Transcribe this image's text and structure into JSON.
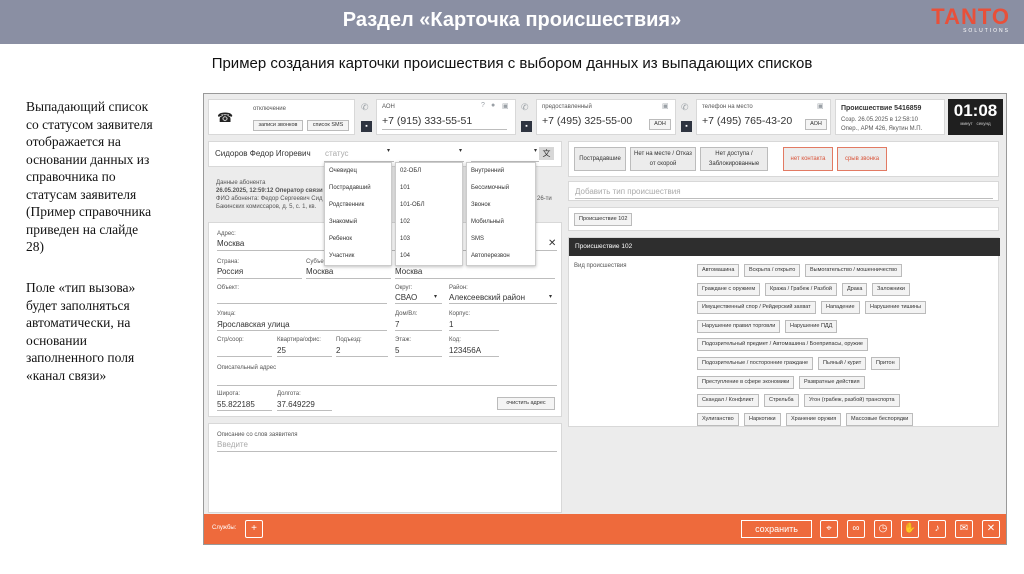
{
  "slide": {
    "title": "Раздел «Карточка происшествия»",
    "subtitle": "Пример создания карточки происшествия с выбором данных из выпадающих списков",
    "logo": {
      "brand": "TANTO",
      "sub": "SOLUTIONS"
    },
    "left_text": {
      "p1": [
        "Выпадающий список",
        "со статусом заявителя",
        "отображается на",
        "основании данных из",
        "справочника по",
        "статусам заявителя",
        "(Пример справочника",
        "приведен на слайде",
        "28)"
      ],
      "p2": [
        "Поле «тип вызова»",
        "будет заполняться",
        "автоматически, на",
        "основании",
        "заполненного поля",
        "«канал связи»"
      ]
    }
  },
  "app": {
    "header": {
      "status_label": "отключение",
      "btn_records": "записи звонков",
      "btn_sms": "список SMS",
      "aon_label": "АОН",
      "aon_number": "+7 (915) 333-55-51",
      "provided_label": "предоставленный",
      "provided_number": "+7 (495) 325-55-00",
      "aon_tag1": "АОН",
      "onsite_label": "телефон на место",
      "onsite_number": "+7 (495) 765-43-20",
      "aon_tag2": "АОН",
      "incident_title": "Происшествие 5416859",
      "incident_created": "Созр. 26.05.2025 в 12:58:10",
      "incident_operator": "Опер., АРМ 426, Якутин М.П.",
      "timer": "01:08",
      "timer_min": "минут",
      "timer_sec": "секунд"
    },
    "caller": {
      "name": "Сидоров Федор Игоревич",
      "status_placeholder": "статус",
      "subscriber_label": "Данные абонента",
      "subscriber_date": "26.05.2025, 12:59:12",
      "subscriber_op": "Оператор связи",
      "subscriber_fio": "ФИО абонента: Федор Сергеевич Сид",
      "subscriber_addr": "Бакинских комиссаров, д. 5, с. 1, кв.",
      "partial": "26-ти"
    },
    "dropdowns": {
      "status_options": [
        "Очевидец",
        "Пострадавший",
        "Родственник",
        "Знакомый",
        "Ребенок",
        "Участник"
      ],
      "channel_options": [
        "02-ОБЛ",
        "101",
        "101-ОБЛ",
        "102",
        "103",
        "104"
      ],
      "type_options": [
        "Внутренний",
        "Бессимочный",
        "Звонок",
        "Мобильный",
        "SMS",
        "Автоперезвон"
      ]
    },
    "address": {
      "address_label": "Адрес:",
      "address_value": "Москва",
      "country_label": "Страна:",
      "country_value": "Россия",
      "subject_label": "Субъект:",
      "subject_value": "Москва",
      "locality_value": "Москва",
      "object_label": "Объект:",
      "okrug_label": "Округ:",
      "okrug_value": "СВАО",
      "district_label": "Район:",
      "district_value": "Алексеевский район",
      "street_label": "Улица:",
      "street_value": "Ярославская улица",
      "house_label": "Дом/Вл:",
      "house_value": "7",
      "korpus_label": "Корпус:",
      "korpus_value": "1",
      "building_label": "Стр/соор:",
      "flat_label": "Квартира/офис:",
      "flat_value": "25",
      "entrance_label": "Подъезд:",
      "entrance_value": "2",
      "floor_label": "Этаж:",
      "floor_value": "5",
      "code_label": "Код:",
      "code_value": "123456А",
      "descr_label": "Описательный адрес",
      "lat_label": "Широта:",
      "lat_value": "55.822185",
      "lon_label": "Долгота:",
      "lon_value": "37.649229",
      "clear_btn": "очистить адрес"
    },
    "description": {
      "label": "Описание со слов заявителя",
      "placeholder": "Введите"
    },
    "right": {
      "btn_victims": "Пострадавшие",
      "btn_notonsite": "Нет на месте / Отказ от скорой",
      "btn_noaccess": "Нет доступа / Заблокированные",
      "btn_nocontact": "нет контакта",
      "btn_dropcall": "срыв звонка",
      "add_type_placeholder": "Добавить тип происшествия",
      "chip_102": "Происшествие 102",
      "section_title": "Происшествие 102",
      "kind_label": "Вид происшествия",
      "tags": [
        [
          "Автомашина",
          "Вскрыта / открыто",
          "Вымогательство / мошенничество"
        ],
        [
          "Граждане с оружием",
          "Кража / Грабеж / Разбой",
          "Драка",
          "Заложники"
        ],
        [
          "Имущественный спор / Рейдерский захват",
          "Нападение",
          "Нарушение тишины"
        ],
        [
          "Нарушение правил торговли",
          "Нарушение ПДД"
        ],
        [
          "Подозрительный предмет / Автомашина / Боеприпасы, оружие"
        ],
        [
          "Подозрительные / посторонние граждане",
          "Пьяный / курит",
          "Притон"
        ],
        [
          "Преступление в сфере экономики",
          "Развратные действия"
        ],
        [
          "Скандал / Конфликт",
          "Стрельба",
          "Угон (грабеж, разбой) транспорта"
        ],
        [
          "Хулиганство",
          "Наркотики",
          "Хранение оружия",
          "Массовые беспорядки"
        ]
      ]
    },
    "footer": {
      "services_label": "Службы:",
      "add": "+",
      "save": "сохранить"
    }
  }
}
